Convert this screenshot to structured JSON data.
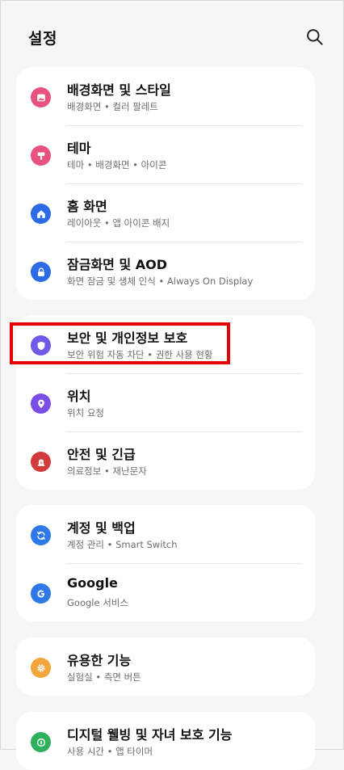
{
  "header": {
    "title": "설정",
    "search_icon": "search-icon"
  },
  "colors": {
    "wallpaper": "#e8527e",
    "theme": "#e8527e",
    "home": "#2c6ae6",
    "lock": "#2c6ae6",
    "security": "#6d5ae6",
    "location": "#7a4ee6",
    "safety": "#d13b3b",
    "accounts": "#2f78e8",
    "google": "#2f78e8",
    "advanced": "#f2a53a",
    "wellbeing": "#2db05c",
    "highlight": "#e60000"
  },
  "groups": [
    {
      "items": [
        {
          "label": "배경화면 및 스타일",
          "sub": "배경화면 • 컬러 팔레트",
          "icon": "image-icon"
        },
        {
          "label": "테마",
          "sub": "테마 • 배경화면 • 아이콘",
          "icon": "paintbrush-icon"
        },
        {
          "label": "홈 화면",
          "sub": "레이아웃 • 앱 아이콘 배지",
          "icon": "home-icon"
        },
        {
          "label": "잠금화면 및 AOD",
          "sub": "화면 잠금 및 생체 인식 • Always On Display",
          "icon": "lock-icon"
        }
      ]
    },
    {
      "items": [
        {
          "label": "보안 및 개인정보 보호",
          "sub": "보안 위험 자동 차단 • 권한 사용 현황",
          "icon": "shield-icon"
        },
        {
          "label": "위치",
          "sub": "위치 요청",
          "icon": "location-pin-icon"
        },
        {
          "label": "안전 및 긴급",
          "sub": "의료정보 • 재난문자",
          "icon": "siren-icon"
        }
      ]
    },
    {
      "items": [
        {
          "label": "계정 및 백업",
          "sub": "계정 관리 • Smart Switch",
          "icon": "sync-icon"
        },
        {
          "label": "Google",
          "sub": "Google 서비스",
          "icon": "google-icon"
        }
      ]
    },
    {
      "items": [
        {
          "label": "유용한 기능",
          "sub": "실험실 • 측면 버튼",
          "icon": "gear-icon"
        }
      ]
    },
    {
      "items": [
        {
          "label": "디지털 웰빙 및 자녀 보호 기능",
          "sub": "사용 시간 • 앱 타이머",
          "icon": "wellbeing-icon"
        }
      ]
    }
  ]
}
